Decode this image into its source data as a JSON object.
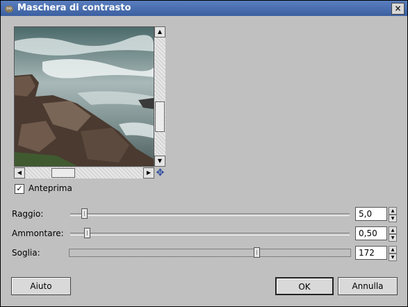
{
  "window": {
    "title": "Maschera di contrasto",
    "close_label": "×"
  },
  "preview": {
    "checkbox_label": "Anteprima",
    "checked": true,
    "check_mark": "✓"
  },
  "sliders": [
    {
      "label": "Raggio:",
      "value": "5,0",
      "fraction": 0.05
    },
    {
      "label": "Ammontare:",
      "value": "0,50",
      "fraction": 0.06
    },
    {
      "label": "Soglia:",
      "value": "172",
      "fraction": 0.67
    }
  ],
  "buttons": {
    "help": "Aiuto",
    "ok": "OK",
    "cancel": "Annulla"
  },
  "icons": {
    "window": "gimp-icon",
    "navigate": "navigate-icon"
  }
}
